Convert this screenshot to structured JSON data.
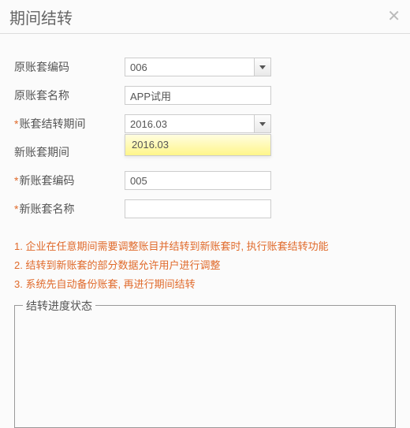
{
  "header": {
    "title": "期间结转",
    "closeIcon": "✕"
  },
  "form": {
    "origCode": {
      "label": "原账套编码",
      "value": "006",
      "required": false
    },
    "origName": {
      "label": "原账套名称",
      "value": "APP试用",
      "required": false
    },
    "period": {
      "label": "账套结转期间",
      "value": "2016.03",
      "required": true,
      "options": [
        "2016.03"
      ]
    },
    "newPeriod": {
      "label": "新账套期间",
      "value": "",
      "required": false
    },
    "newCode": {
      "label": "新账套编码",
      "value": "005",
      "required": true
    },
    "newName": {
      "label": "新账套名称",
      "value": "",
      "required": true
    }
  },
  "notes": [
    "1. 企业在任意期间需要调整账目并结转到新账套时, 执行账套结转功能",
    "2. 结转到新账套的部分数据允许用户进行调整",
    "3. 系统先自动备份账套, 再进行期间结转"
  ],
  "statusGroup": {
    "legend": "结转进度状态"
  }
}
